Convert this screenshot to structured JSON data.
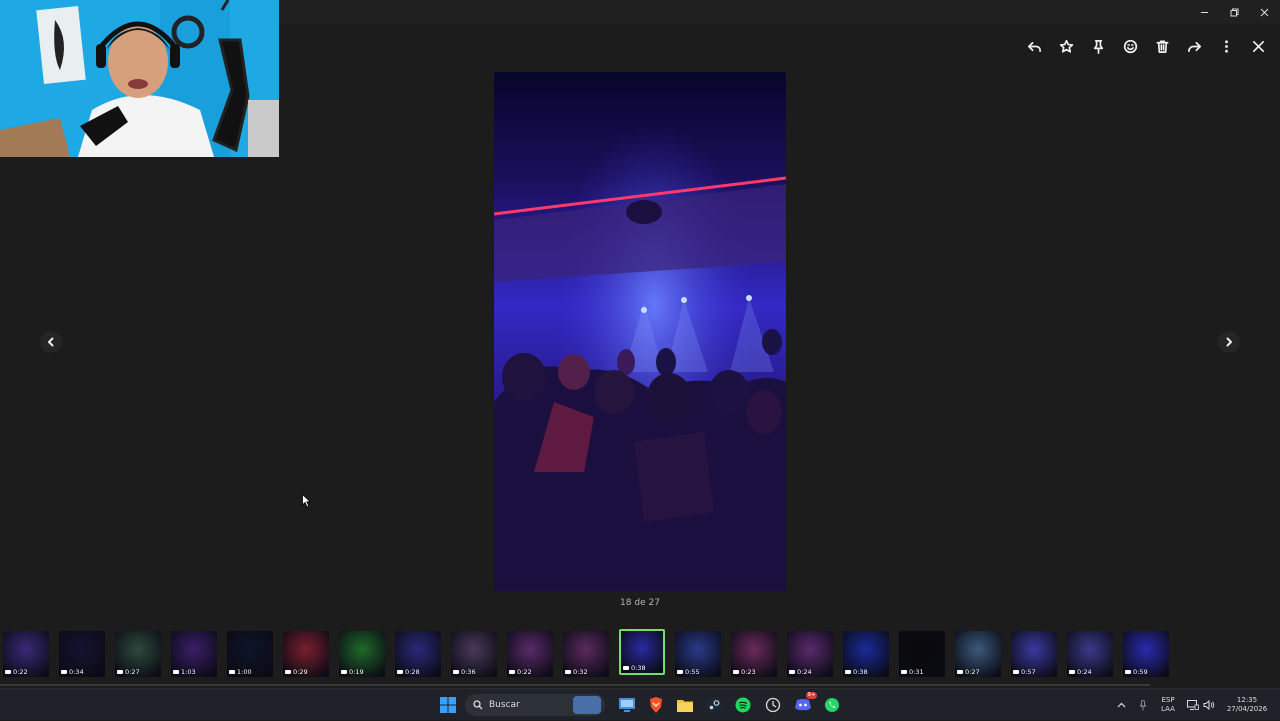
{
  "viewer": {
    "counter": "18 de 27",
    "toolbar": [
      {
        "name": "reply-icon",
        "label": "Responder"
      },
      {
        "name": "star-icon",
        "label": "Destacar"
      },
      {
        "name": "pin-icon",
        "label": "Fijar"
      },
      {
        "name": "emoji-icon",
        "label": "Reaccionar"
      },
      {
        "name": "trash-icon",
        "label": "Eliminar"
      },
      {
        "name": "forward-icon",
        "label": "Reenviar"
      },
      {
        "name": "more-icon",
        "label": "Más opciones"
      },
      {
        "name": "close-icon",
        "label": "Cerrar"
      }
    ]
  },
  "filmstrip": {
    "durations": [
      "0:22",
      "0:34",
      "0:27",
      "1:03",
      "1:00",
      "0:29",
      "0:19",
      "0:28",
      "0:36",
      "0:22",
      "0:32",
      "0:38",
      "0:55",
      "0:23",
      "0:24",
      "0:38",
      "0:31",
      "0:27",
      "0:57",
      "0:24",
      "0:59"
    ],
    "selected_index": 11,
    "colors": [
      "#3a2a78",
      "#141432",
      "#2e4a3c",
      "#3b1f6a",
      "#0e1528",
      "#7a1f2e",
      "#1f6a2a",
      "#2a2a7a",
      "#4a3a5a",
      "#5a2a6a",
      "#5a2a5e",
      "#2a2aa0",
      "#2a3a8a",
      "#6a2a5a",
      "#5a2a6e",
      "#1a2a9a",
      "#0a0a0a",
      "#3a5a7a",
      "#3a3aa0",
      "#3a3a8a",
      "#2a2ab0"
    ]
  },
  "taskbar": {
    "search_placeholder": "Buscar",
    "language_line1": "ESP",
    "language_line2": "LAA",
    "time": "12:35",
    "date": "27/04/2026",
    "discord_badge": "9+"
  },
  "colors": {
    "accent_selected": "#6fe06a",
    "background": "#1c1c1c"
  }
}
